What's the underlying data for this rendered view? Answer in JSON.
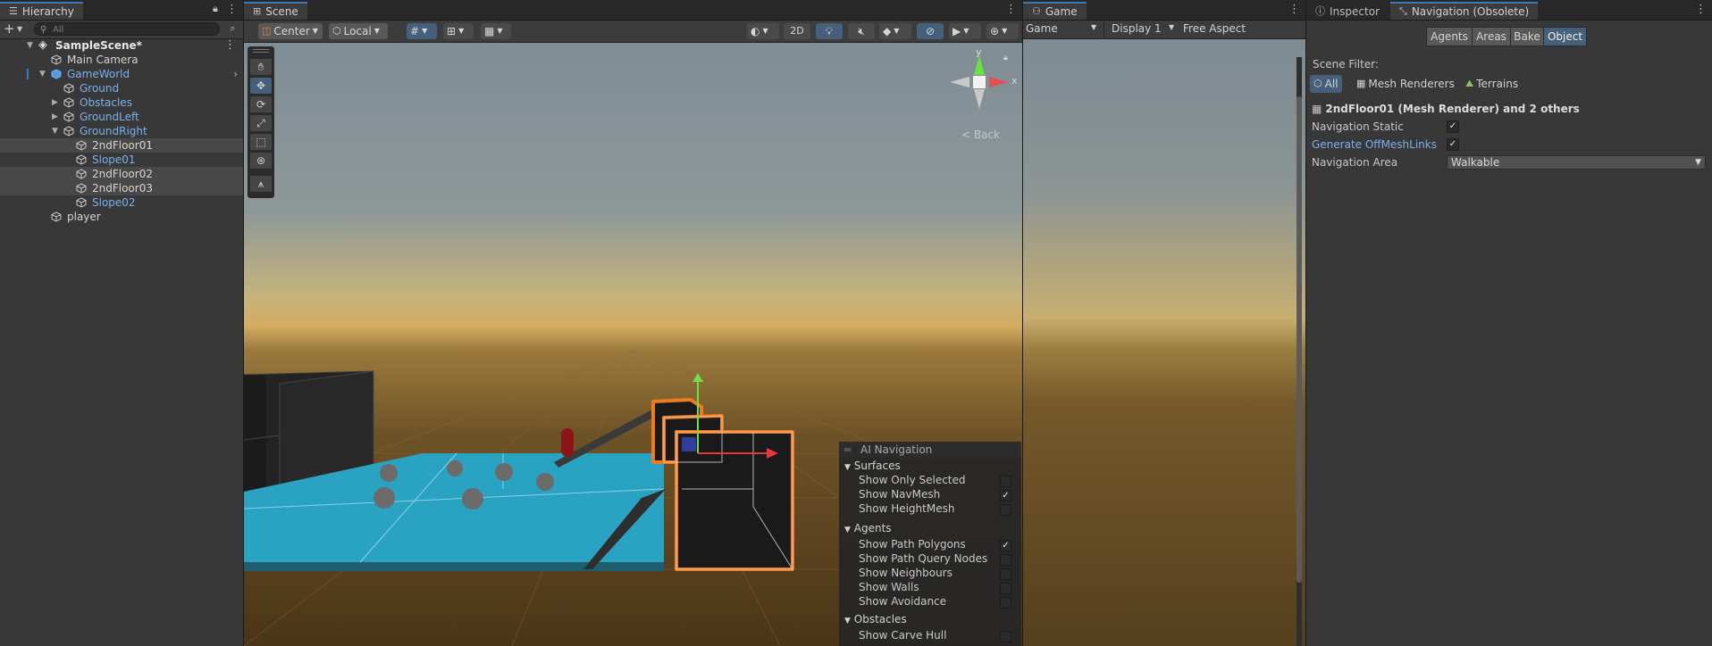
{
  "hierarchy": {
    "tab_label": "Hierarchy",
    "search_placeholder": "All",
    "items": [
      {
        "label": "SampleScene*",
        "style": "bold"
      },
      {
        "label": "Main Camera",
        "style": "white"
      },
      {
        "label": "GameWorld",
        "style": "blue"
      },
      {
        "label": "Ground",
        "style": "blue"
      },
      {
        "label": "Obstacles",
        "style": "blue"
      },
      {
        "label": "GroundLeft",
        "style": "blue"
      },
      {
        "label": "GroundRight",
        "style": "blue"
      },
      {
        "label": "2ndFloor01",
        "style": "white"
      },
      {
        "label": "Slope01",
        "style": "blue"
      },
      {
        "label": "2ndFloor02",
        "style": "white"
      },
      {
        "label": "2ndFloor03",
        "style": "white"
      },
      {
        "label": "Slope02",
        "style": "blue"
      },
      {
        "label": "player",
        "style": "white"
      }
    ]
  },
  "scene": {
    "tab_label": "Scene",
    "toolbar": {
      "pivot": "Center",
      "space": "Local",
      "mode_2d": "2D"
    },
    "gizmo": {
      "y_label": "y",
      "x_label": "x",
      "back_label": "< Back"
    },
    "ai_navigation": {
      "title": "AI Navigation",
      "sections": [
        {
          "name": "Surfaces",
          "items": [
            {
              "label": "Show Only Selected",
              "checked": false
            },
            {
              "label": "Show NavMesh",
              "checked": true
            },
            {
              "label": "Show HeightMesh",
              "checked": false
            }
          ]
        },
        {
          "name": "Agents",
          "items": [
            {
              "label": "Show Path Polygons",
              "checked": true
            },
            {
              "label": "Show Path Query Nodes",
              "checked": false
            },
            {
              "label": "Show Neighbours",
              "checked": false
            },
            {
              "label": "Show Walls",
              "checked": false
            },
            {
              "label": "Show Avoidance",
              "checked": false
            }
          ]
        },
        {
          "name": "Obstacles",
          "items": [
            {
              "label": "Show Carve Hull",
              "checked": false
            }
          ]
        }
      ]
    }
  },
  "game": {
    "tab_label": "Game",
    "mode": "Game",
    "display": "Display 1",
    "aspect": "Free Aspect"
  },
  "inspector": {
    "tab_inspector": "Inspector",
    "tab_navigation": "Navigation (Obsolete)",
    "segments": [
      "Agents",
      "Areas",
      "Bake",
      "Object"
    ],
    "scene_filter_label": "Scene Filter:",
    "filters": [
      "All",
      "Mesh Renderers",
      "Terrains"
    ],
    "object_title": "2ndFloor01 (Mesh Renderer) and 2 others",
    "nav_static_label": "Navigation Static",
    "nav_static_checked": true,
    "offmesh_label": "Generate OffMeshLinks",
    "offmesh_checked": true,
    "nav_area_label": "Navigation Area",
    "nav_area_value": "Walkable"
  },
  "colors": {
    "accent": "#46607c",
    "selection_outline": "#f07a1e",
    "navmesh": "#2fa4c4",
    "link_blue": "#7bafef"
  }
}
